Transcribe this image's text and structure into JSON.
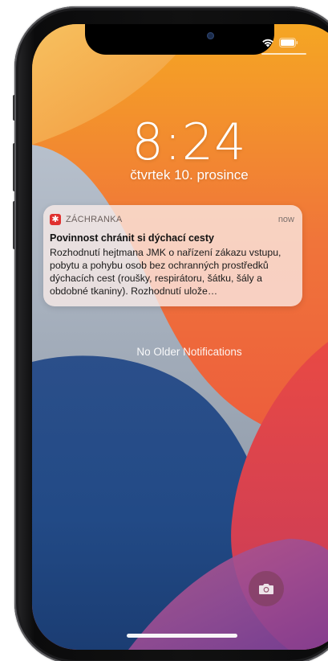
{
  "lockscreen": {
    "time": "8:24",
    "date": "čtvrtek 10. prosince"
  },
  "notification": {
    "app_name": "ZÁCHRANKA",
    "time": "now",
    "title": "Povinnost chránit si dýchací cesty",
    "body": "Rozhodnutí hejtmana JMK o nařízení zákazu vstupu, pobytu a pohybu osob bez ochranných prostředků dýchacích cest (roušky, respirátoru, šátku, šály a obdobné tkaniny). Rozhodnutí ulože…",
    "icon": "star-of-life-icon",
    "accent_color": "#e0312f"
  },
  "no_older_label": "No Older Notifications",
  "controls": {
    "camera_icon": "camera-icon",
    "wifi_icon": "wifi-icon",
    "battery_icon": "battery-icon"
  }
}
